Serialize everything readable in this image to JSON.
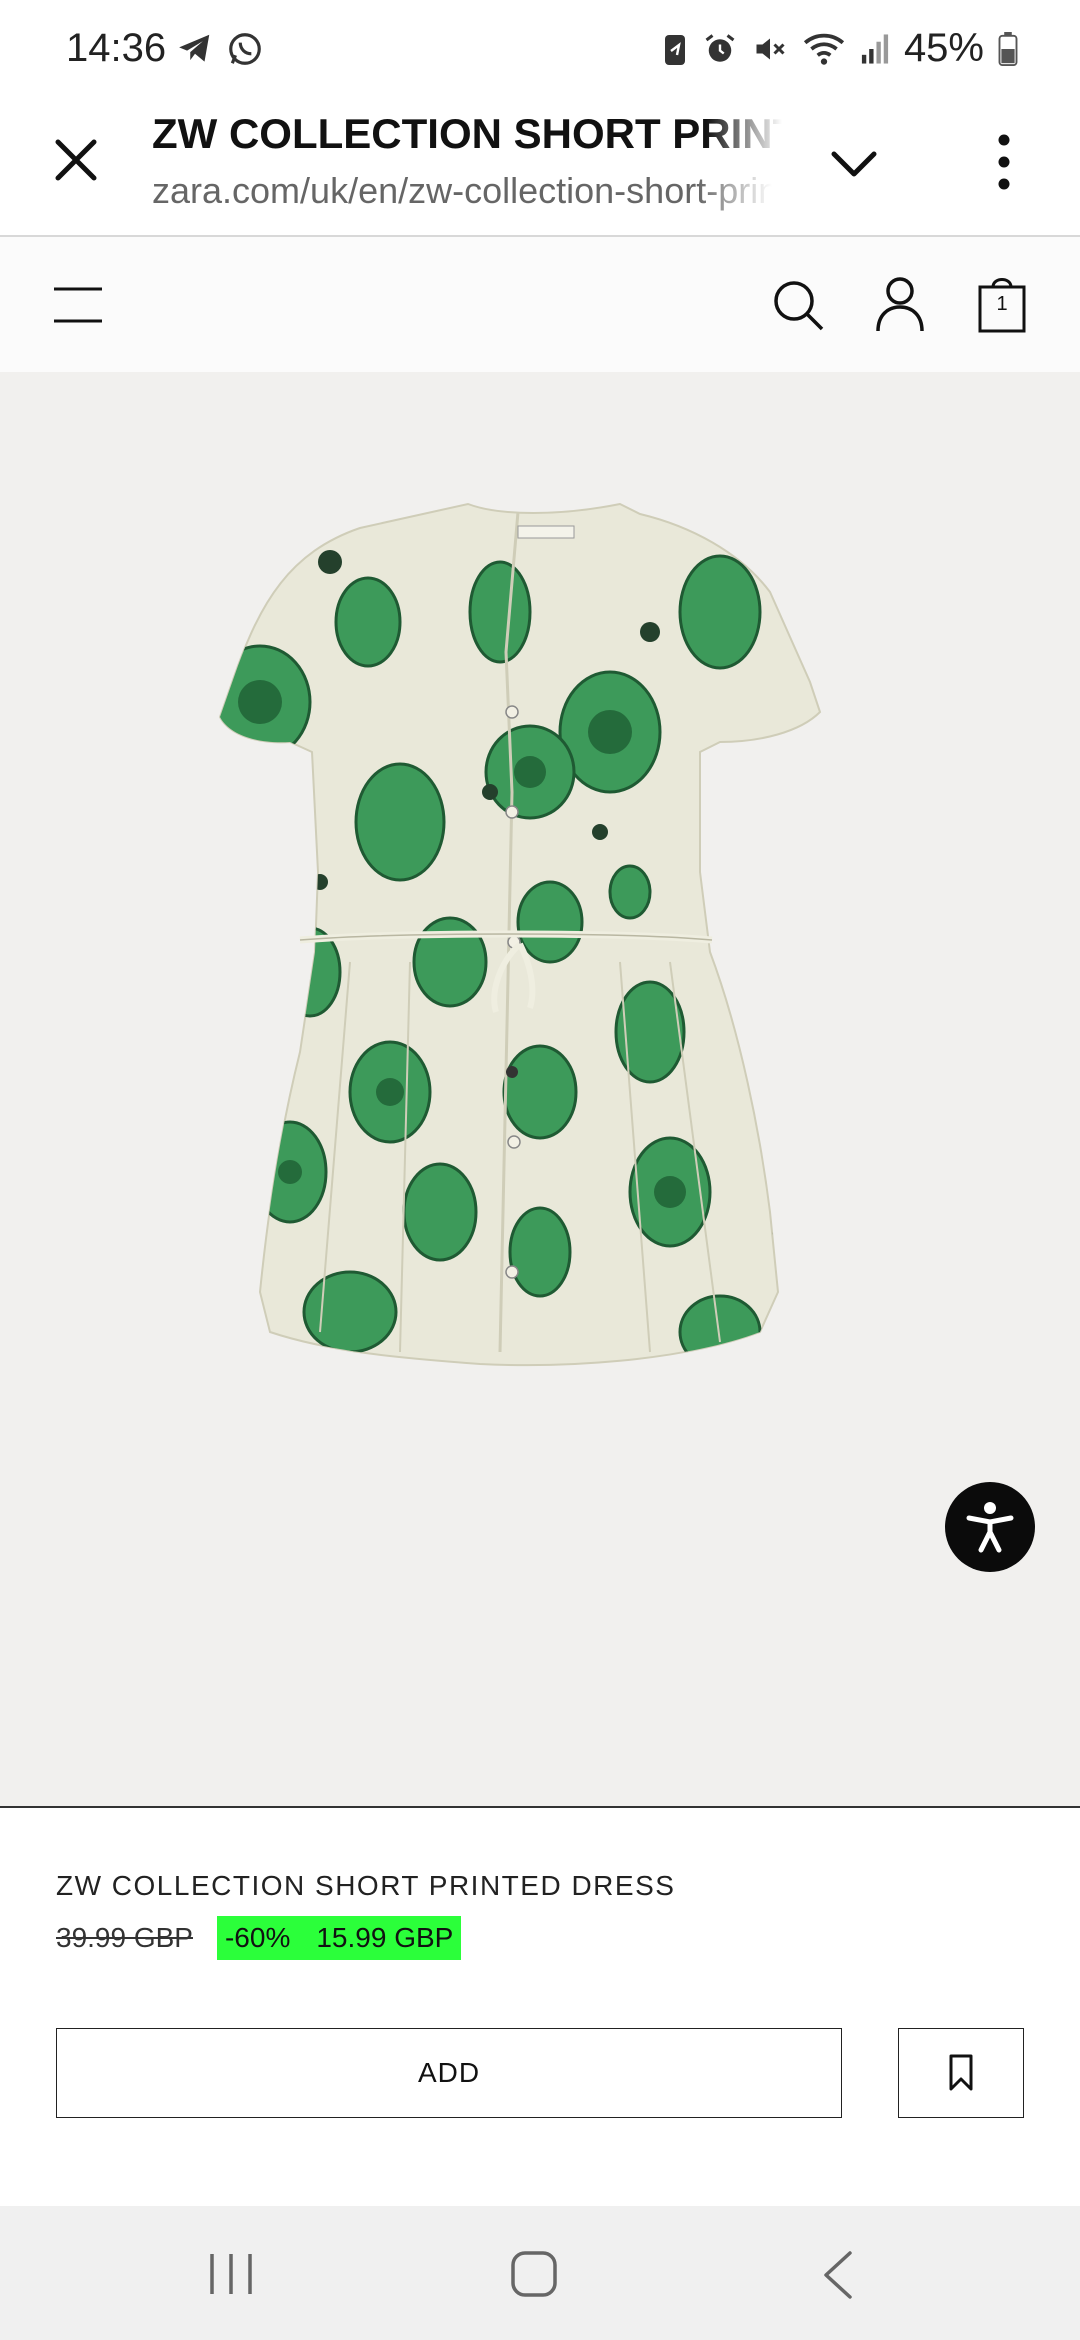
{
  "status_bar": {
    "time": "14:36",
    "battery": "45%",
    "left_icons": [
      "telegram-icon",
      "whatsapp-icon"
    ],
    "right_icons": [
      "battery-saver-icon",
      "alarm-icon",
      "mute-icon",
      "wifi-icon",
      "signal-icon",
      "battery-icon"
    ]
  },
  "browser": {
    "title": "ZW COLLECTION SHORT PRINTED DRESS",
    "url": "zara.com/uk/en/zw-collection-short-printed-dress"
  },
  "header": {
    "bag_count": "1"
  },
  "product": {
    "name": "ZW COLLECTION SHORT PRINTED DRESS",
    "old_price": "39.99 GBP",
    "discount": "-60%",
    "new_price": "15.99 GBP",
    "add_label": "ADD",
    "colors": {
      "sale_badge": "#2bff3a",
      "image_bg": "#f1f0ee",
      "print_green": "#2f8a4a"
    }
  }
}
